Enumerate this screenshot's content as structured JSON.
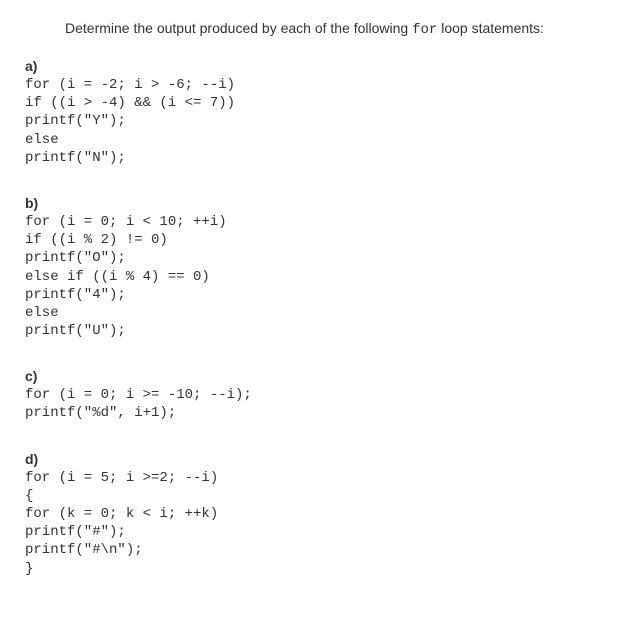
{
  "question": {
    "prefix": "Determine the output produced by each of the following ",
    "code_word": "for",
    "suffix": " loop statements:"
  },
  "parts": [
    {
      "label": "a)",
      "code": "for (i = -2; i > -6; --i)\nif ((i > -4) && (i <= 7))\nprintf(\"Y\");\nelse\nprintf(\"N\");"
    },
    {
      "label": "b)",
      "code": "for (i = 0; i < 10; ++i)\nif ((i % 2) != 0)\nprintf(\"O\");\nelse if ((i % 4) == 0)\nprintf(\"4\");\nelse\nprintf(\"U\");"
    },
    {
      "label": "c)",
      "code": "for (i = 0; i >= -10; --i);\nprintf(\"%d\", i+1);"
    },
    {
      "label": "d)",
      "code": "for (i = 5; i >=2; --i)\n{\nfor (k = 0; k < i; ++k)\nprintf(\"#\");\nprintf(\"#\\n\");\n}"
    }
  ]
}
